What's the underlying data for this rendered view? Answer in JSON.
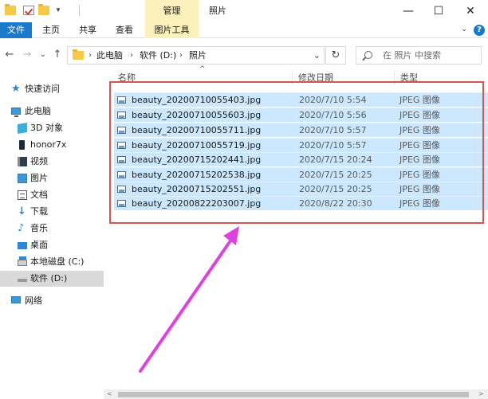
{
  "window": {
    "title": "照片",
    "context_tab": "管理",
    "controls": {
      "minimize": "—",
      "maximize": "☐",
      "close": "✕"
    }
  },
  "ribbon": {
    "tabs": [
      "文件",
      "主页",
      "共享",
      "查看",
      "图片工具"
    ],
    "collapse_glyph": "⌄",
    "help_glyph": "?"
  },
  "address": {
    "back": "←",
    "forward": "→",
    "recent": "⌄",
    "up": "↑",
    "crumbs": [
      "此电脑",
      "软件 (D:)",
      "照片"
    ],
    "crumb_sep": "›",
    "dropdown": "⌄",
    "refresh": "↻",
    "search_placeholder": "在 照片 中搜索"
  },
  "sidebar": {
    "items": [
      {
        "label": "快速访问",
        "icon": "star-icon"
      },
      {
        "label": "此电脑",
        "icon": "computer-icon"
      },
      {
        "label": "3D 对象",
        "icon": "3d-objects-icon"
      },
      {
        "label": "honor7x",
        "icon": "phone-icon"
      },
      {
        "label": "视频",
        "icon": "video-icon"
      },
      {
        "label": "图片",
        "icon": "picture-icon"
      },
      {
        "label": "文档",
        "icon": "document-icon"
      },
      {
        "label": "下载",
        "icon": "download-icon"
      },
      {
        "label": "音乐",
        "icon": "music-icon"
      },
      {
        "label": "桌面",
        "icon": "desktop-icon"
      },
      {
        "label": "本地磁盘 (C:)",
        "icon": "drive-icon"
      },
      {
        "label": "软件 (D:)",
        "icon": "drive-icon",
        "selected": true
      },
      {
        "label": "网络",
        "icon": "network-icon"
      }
    ]
  },
  "columns": {
    "name": "名称",
    "date": "修改日期",
    "type": "类型",
    "sort_glyph": "^"
  },
  "files": [
    {
      "name": "beauty_20200710055403.jpg",
      "date": "2020/7/10 5:54",
      "type": "JPEG 图像"
    },
    {
      "name": "beauty_20200710055603.jpg",
      "date": "2020/7/10 5:56",
      "type": "JPEG 图像"
    },
    {
      "name": "beauty_20200710055711.jpg",
      "date": "2020/7/10 5:57",
      "type": "JPEG 图像"
    },
    {
      "name": "beauty_20200710055719.jpg",
      "date": "2020/7/10 5:57",
      "type": "JPEG 图像"
    },
    {
      "name": "beauty_20200715202441.jpg",
      "date": "2020/7/15 20:24",
      "type": "JPEG 图像"
    },
    {
      "name": "beauty_20200715202538.jpg",
      "date": "2020/7/15 20:25",
      "type": "JPEG 图像"
    },
    {
      "name": "beauty_20200715202551.jpg",
      "date": "2020/7/15 20:25",
      "type": "JPEG 图像"
    },
    {
      "name": "beauty_20200822203007.jpg",
      "date": "2020/8/22 20:30",
      "type": "JPEG 图像"
    }
  ],
  "annotation": {
    "highlight_color": "#d9534f",
    "arrow_color": "#e040e0"
  },
  "scrollbar": {
    "left": "<",
    "right": ">"
  }
}
